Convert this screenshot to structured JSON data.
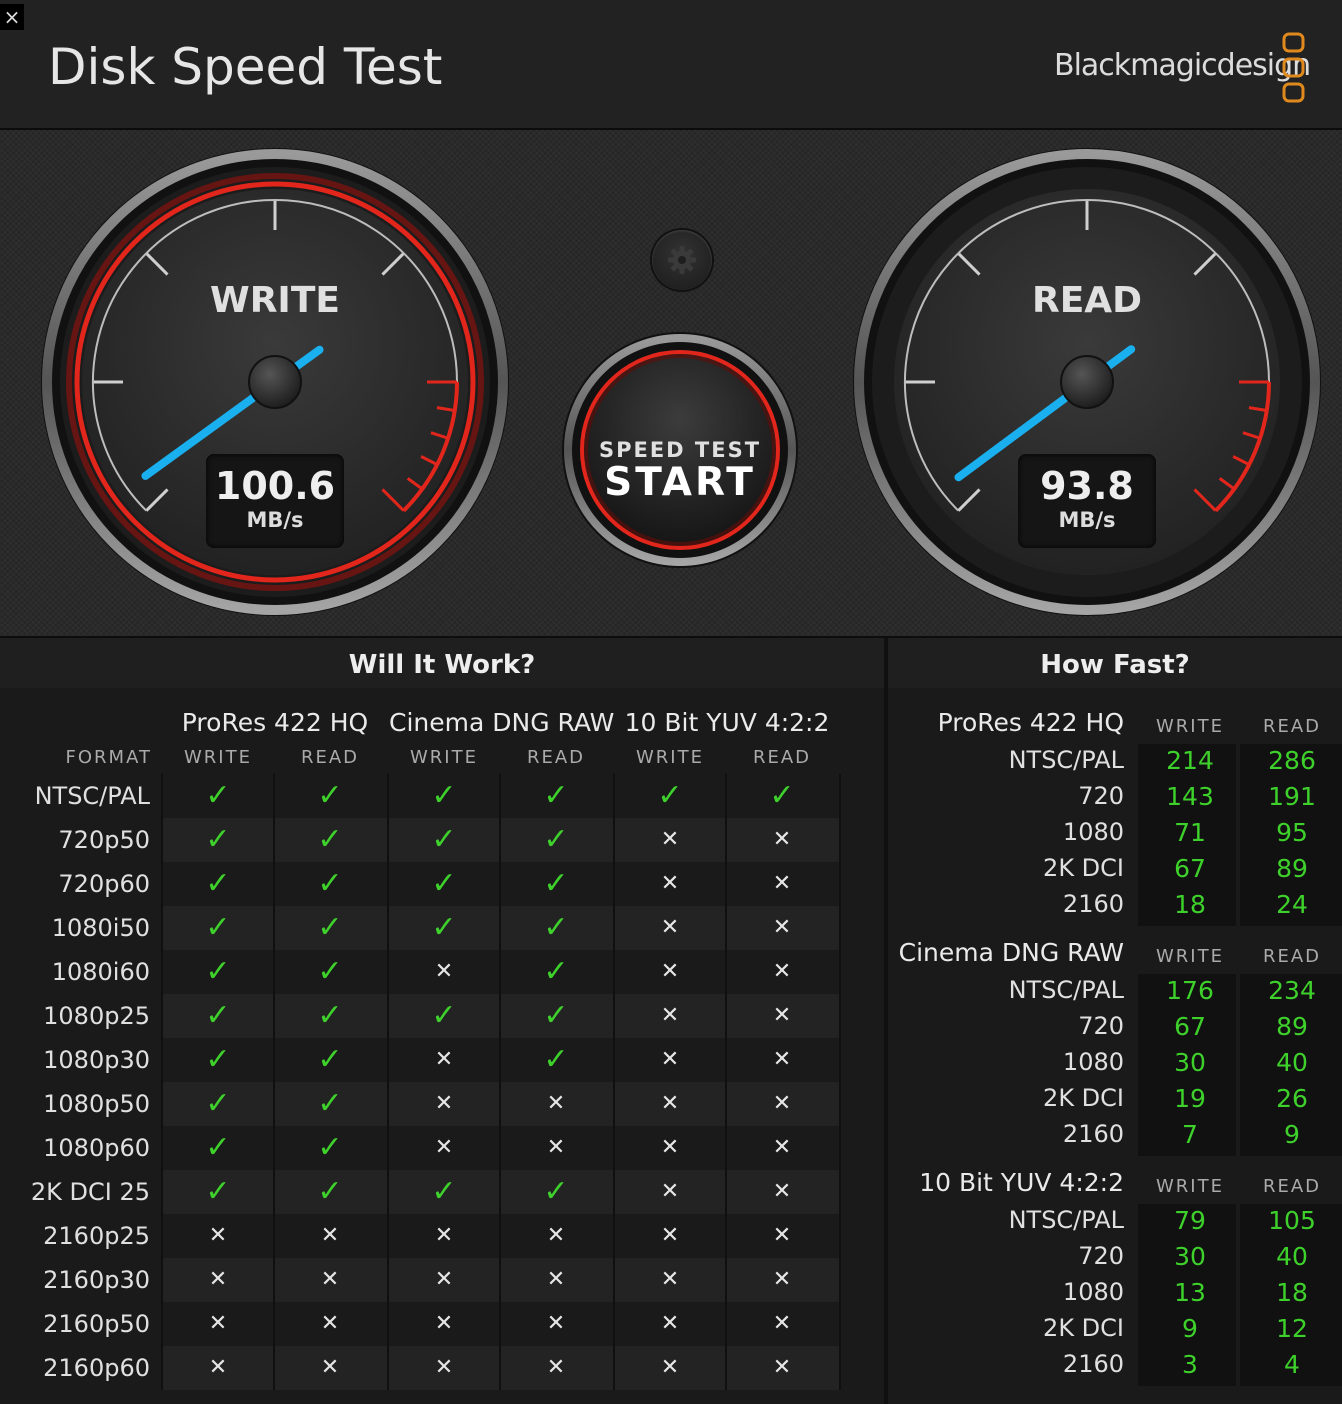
{
  "header": {
    "title": "Disk Speed Test",
    "brand": "Blackmagicdesign",
    "close_icon": "×"
  },
  "gauges": {
    "write": {
      "label": "WRITE",
      "value": "100.6",
      "unit": "MB/s",
      "level": 100.6
    },
    "read": {
      "label": "READ",
      "value": "93.8",
      "unit": "MB/s",
      "level": 93.8
    }
  },
  "start_button": {
    "line1": "SPEED TEST",
    "line2": "START"
  },
  "will_it_work": {
    "title": "Will It Work?",
    "format_label": "FORMAT",
    "codecs": [
      "ProRes 422 HQ",
      "Cinema DNG RAW",
      "10 Bit YUV 4:2:2"
    ],
    "col_labels": [
      "WRITE",
      "READ",
      "WRITE",
      "READ",
      "WRITE",
      "READ"
    ],
    "rows": [
      {
        "format": "NTSC/PAL",
        "cells": [
          1,
          1,
          1,
          1,
          1,
          1
        ]
      },
      {
        "format": "720p50",
        "cells": [
          1,
          1,
          1,
          1,
          0,
          0
        ]
      },
      {
        "format": "720p60",
        "cells": [
          1,
          1,
          1,
          1,
          0,
          0
        ]
      },
      {
        "format": "1080i50",
        "cells": [
          1,
          1,
          1,
          1,
          0,
          0
        ]
      },
      {
        "format": "1080i60",
        "cells": [
          1,
          1,
          0,
          1,
          0,
          0
        ]
      },
      {
        "format": "1080p25",
        "cells": [
          1,
          1,
          1,
          1,
          0,
          0
        ]
      },
      {
        "format": "1080p30",
        "cells": [
          1,
          1,
          0,
          1,
          0,
          0
        ]
      },
      {
        "format": "1080p50",
        "cells": [
          1,
          1,
          0,
          0,
          0,
          0
        ]
      },
      {
        "format": "1080p60",
        "cells": [
          1,
          1,
          0,
          0,
          0,
          0
        ]
      },
      {
        "format": "2K DCI 25",
        "cells": [
          1,
          1,
          1,
          1,
          0,
          0
        ]
      },
      {
        "format": "2160p25",
        "cells": [
          0,
          0,
          0,
          0,
          0,
          0
        ]
      },
      {
        "format": "2160p30",
        "cells": [
          0,
          0,
          0,
          0,
          0,
          0
        ]
      },
      {
        "format": "2160p50",
        "cells": [
          0,
          0,
          0,
          0,
          0,
          0
        ]
      },
      {
        "format": "2160p60",
        "cells": [
          0,
          0,
          0,
          0,
          0,
          0
        ]
      }
    ],
    "check_glyph": "✓",
    "cross_glyph": "✕"
  },
  "how_fast": {
    "title": "How Fast?",
    "write_label": "WRITE",
    "read_label": "READ",
    "groups": [
      {
        "codec": "ProRes 422 HQ",
        "rows": [
          {
            "format": "NTSC/PAL",
            "write": "214",
            "read": "286"
          },
          {
            "format": "720",
            "write": "143",
            "read": "191"
          },
          {
            "format": "1080",
            "write": "71",
            "read": "95"
          },
          {
            "format": "2K DCI",
            "write": "67",
            "read": "89"
          },
          {
            "format": "2160",
            "write": "18",
            "read": "24"
          }
        ]
      },
      {
        "codec": "Cinema DNG RAW",
        "rows": [
          {
            "format": "NTSC/PAL",
            "write": "176",
            "read": "234"
          },
          {
            "format": "720",
            "write": "67",
            "read": "89"
          },
          {
            "format": "1080",
            "write": "30",
            "read": "40"
          },
          {
            "format": "2K DCI",
            "write": "19",
            "read": "26"
          },
          {
            "format": "2160",
            "write": "7",
            "read": "9"
          }
        ]
      },
      {
        "codec": "10 Bit YUV 4:2:2",
        "rows": [
          {
            "format": "NTSC/PAL",
            "write": "79",
            "read": "105"
          },
          {
            "format": "720",
            "write": "30",
            "read": "40"
          },
          {
            "format": "1080",
            "write": "13",
            "read": "18"
          },
          {
            "format": "2K DCI",
            "write": "9",
            "read": "12"
          },
          {
            "format": "2160",
            "write": "3",
            "read": "4"
          }
        ]
      }
    ]
  },
  "colors": {
    "accent_red": "#e3261c",
    "needle_blue": "#1ab0f0",
    "ok_green": "#3ed12b",
    "brand_orange": "#e08a1e"
  }
}
